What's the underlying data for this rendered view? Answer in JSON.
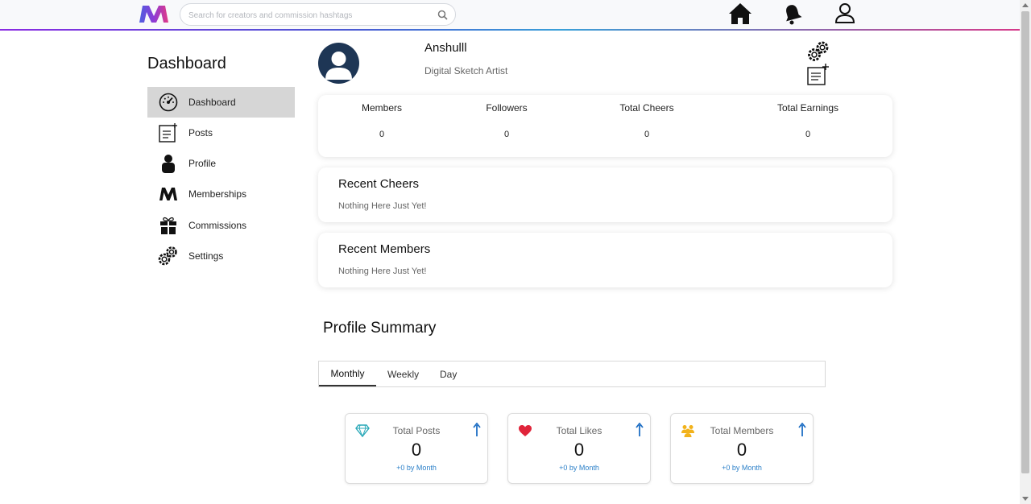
{
  "header": {
    "search_placeholder": "Search for creators and commission hashtags"
  },
  "sidebar": {
    "title": "Dashboard",
    "items": [
      {
        "label": "Dashboard",
        "icon": "speedometer-icon"
      },
      {
        "label": "Posts",
        "icon": "new-post-icon"
      },
      {
        "label": "Profile",
        "icon": "person-icon"
      },
      {
        "label": "Memberships",
        "icon": "m-logo-icon"
      },
      {
        "label": "Commissions",
        "icon": "gift-icon"
      },
      {
        "label": "Settings",
        "icon": "gears-icon"
      }
    ]
  },
  "profile": {
    "name": "Anshulll",
    "role": "Digital Sketch Artist"
  },
  "stats": [
    {
      "label": "Members",
      "value": "0"
    },
    {
      "label": "Followers",
      "value": "0"
    },
    {
      "label": "Total Cheers",
      "value": "0"
    },
    {
      "label": "Total Earnings",
      "value": "0"
    }
  ],
  "recent_cheers": {
    "title": "Recent Cheers",
    "empty": "Nothing Here Just Yet!"
  },
  "recent_members": {
    "title": "Recent Members",
    "empty": "Nothing Here Just Yet!"
  },
  "summary": {
    "title": "Profile Summary",
    "tabs": [
      "Monthly",
      "Weekly",
      "Day"
    ],
    "active_tab": "Monthly",
    "metrics": [
      {
        "label": "Total Posts",
        "value": "0",
        "sub": "+0 by Month",
        "icon": "diamond-icon",
        "icon_color": "#2aa9b8"
      },
      {
        "label": "Total Likes",
        "value": "0",
        "sub": "+0 by Month",
        "icon": "heart-icon",
        "icon_color": "#e0243a"
      },
      {
        "label": "Total Members",
        "value": "0",
        "sub": "+0 by Month",
        "icon": "group-icon",
        "icon_color": "#f2b21b"
      }
    ]
  },
  "colors": {
    "accent_blue": "#2a7fc8",
    "avatar_bg": "#1e3655",
    "active_nav_bg": "#d6d6d6"
  }
}
